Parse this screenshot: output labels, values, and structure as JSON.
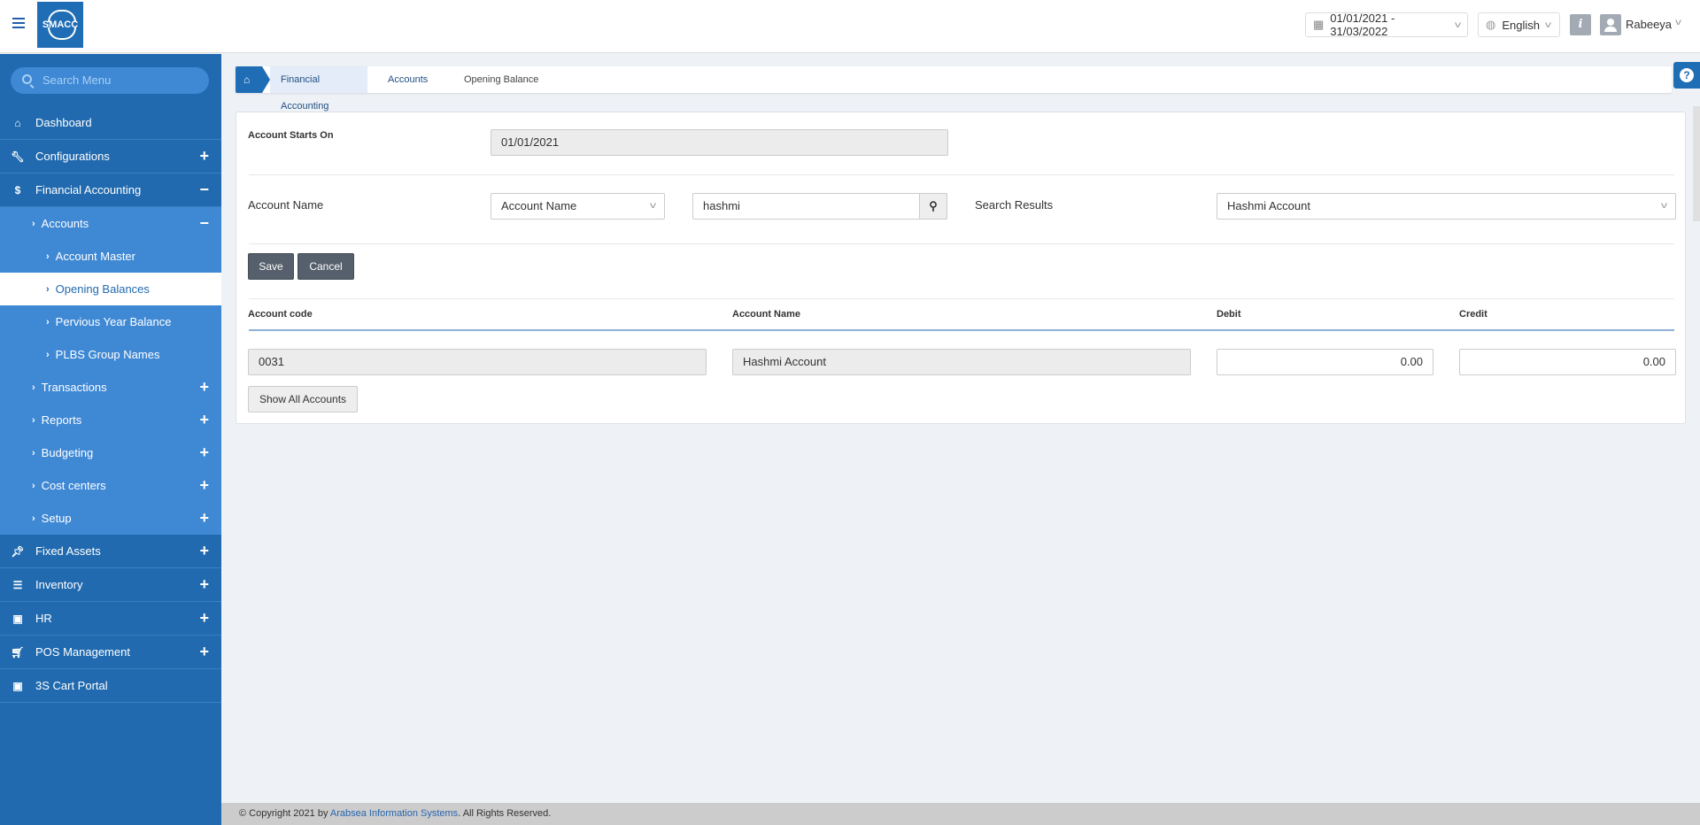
{
  "header": {
    "logo": "SMACC",
    "date_range": "01/01/2021 - 31/03/2022",
    "language": "English",
    "info": "i",
    "user": "Rabeeya"
  },
  "sidebar": {
    "search_placeholder": "Search Menu",
    "items": [
      {
        "label": "Dashboard",
        "icon": "home-icon"
      },
      {
        "label": "Configurations",
        "icon": "wrench-icon",
        "toggle": "+"
      },
      {
        "label": "Financial Accounting",
        "icon": "dollar-icon",
        "toggle": "−"
      },
      {
        "label": "Accounts",
        "toggle": "−"
      },
      {
        "label": "Account Master"
      },
      {
        "label": "Opening Balances"
      },
      {
        "label": "Pervious Year Balance"
      },
      {
        "label": "PLBS Group Names"
      },
      {
        "label": "Transactions",
        "toggle": "+"
      },
      {
        "label": "Reports",
        "toggle": "+"
      },
      {
        "label": "Budgeting",
        "toggle": "+"
      },
      {
        "label": "Cost centers",
        "toggle": "+"
      },
      {
        "label": "Setup",
        "toggle": "+"
      },
      {
        "label": "Fixed Assets",
        "icon": "pin-icon",
        "toggle": "+"
      },
      {
        "label": "Inventory",
        "icon": "list-icon",
        "toggle": "+"
      },
      {
        "label": "HR",
        "icon": "money-icon",
        "toggle": "+"
      },
      {
        "label": "POS Management",
        "icon": "cart-icon",
        "toggle": "+"
      },
      {
        "label": "3S Cart Portal",
        "icon": "money-icon"
      }
    ]
  },
  "breadcrumb": [
    "Financial Accounting",
    "Accounts",
    "Opening Balance"
  ],
  "form": {
    "starts_on_label": "Account Starts On",
    "starts_on_value": "01/01/2021",
    "account_name_label": "Account Name",
    "search_by": "Account Name",
    "search_value": "hashmi",
    "search_results_label": "Search Results",
    "search_result": "Hashmi Account",
    "save": "Save",
    "cancel": "Cancel"
  },
  "table": {
    "headers": [
      "Account code",
      "Account Name",
      "Debit",
      "Credit"
    ],
    "row": {
      "code": "0031",
      "name": "Hashmi Account",
      "debit": "0.00",
      "credit": "0.00"
    },
    "show_all": "Show All Accounts"
  },
  "footer": {
    "prefix": "© Copyright 2021 by ",
    "company": "Arabsea Information Systems",
    "suffix": ". All Rights Reserved."
  }
}
